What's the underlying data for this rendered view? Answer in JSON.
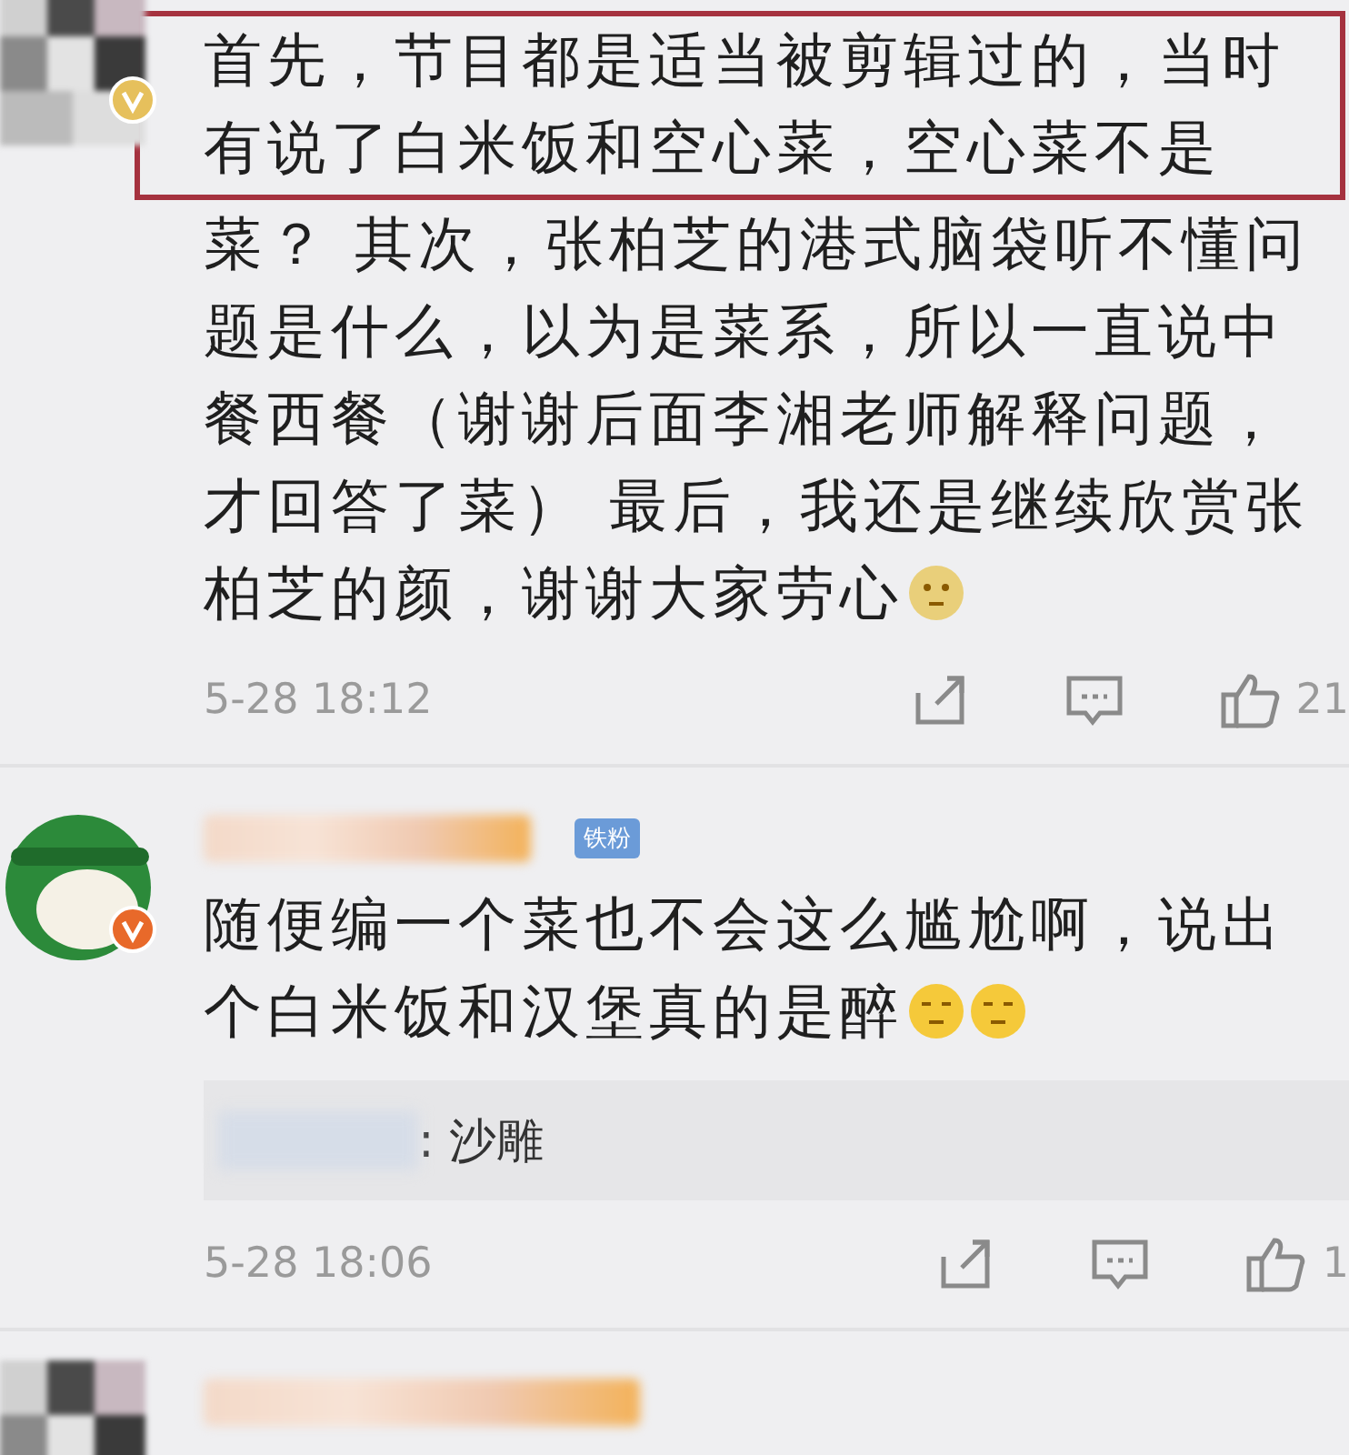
{
  "comments": [
    {
      "kind": "cut-top",
      "avatar": {
        "verified": true
      },
      "lines": [
        {
          "text": "首先，节目都是适当被剪辑过的，当时",
          "highlighted": true
        },
        {
          "text": "有说了白米饭和空心菜，空心菜不是",
          "highlighted": true
        },
        {
          "text": "菜？ 其次，张柏芝的港式脑袋听不懂问",
          "highlighted": false
        },
        {
          "text": "题是什么，以为是菜系，所以一直说中",
          "highlighted": false
        },
        {
          "text": "餐西餐（谢谢后面李湘老师解释问题，",
          "highlighted": false
        },
        {
          "text": "才回答了菜） 最后，我还是继续欣赏张",
          "highlighted": false
        },
        {
          "text": "柏芝的颜，谢谢大家劳心",
          "highlighted": false,
          "emojis": [
            {
              "kind": "blush"
            }
          ]
        }
      ],
      "timestamp": "5-28 18:12",
      "like_count": "21"
    },
    {
      "kind": "full",
      "avatar": {
        "verified": true
      },
      "badge": "铁粉",
      "lines": [
        {
          "text": "随便编一个菜也不会这么尴尬啊，说出",
          "highlighted": false
        },
        {
          "text": "个白米饭和汉堡真的是醉",
          "highlighted": false,
          "emojis": [
            {
              "kind": "smirk"
            },
            {
              "kind": "smirk"
            }
          ]
        }
      ],
      "reply": ": 沙雕",
      "timestamp": "5-28 18:06",
      "like_count": "1"
    },
    {
      "kind": "cut-bottom",
      "avatar": {
        "verified": false
      }
    }
  ]
}
